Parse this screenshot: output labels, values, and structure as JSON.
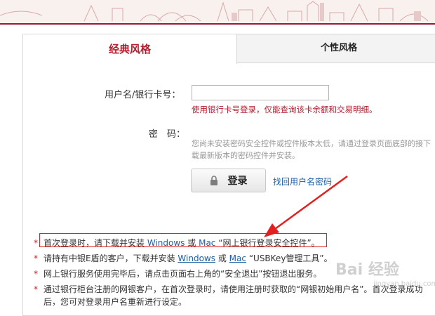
{
  "tabs": {
    "classic": "经典风格",
    "personal": "个性风格"
  },
  "form": {
    "username_label": "用户名/银行卡号：",
    "username_value": "",
    "username_hint": "使用银行卡号登录，仅能查询该卡余额和交易明细。",
    "password_label": "密　码：",
    "password_hint": "您尚未安装密码安全控件或控件版本太低，请通过登录页面底部的接下载最新版本的密码控件并安装。",
    "login_button": "登录",
    "forgot_link": "找回用户名密码"
  },
  "notices": {
    "star": "*",
    "n1_text_a": "首次登录时，请下载并安装",
    "n1_windows": "Windows",
    "n1_or": "或",
    "n1_mac": "Mac",
    "n1_text_b": "“网上银行登录安全控件”。",
    "n2_text_a": "请持有中银E盾的客户，下载并安装",
    "n2_windows": "Windows",
    "n2_or": "或",
    "n2_mac": "Mac",
    "n2_text_b": "“USBKey管理工具”。",
    "n3_text": "网上银行服务使用完毕后，请点击页面右上角的“安全退出”按钮退出服务。",
    "n4_text_a": "通过银行柜台注册的网银客户，在首次登录时，请使用注册时获取的“网银初始用户名”。",
    "n4_text_b": "首次登录成功",
    "n5_text": "后，您可对登录用户名重新进行设定。"
  },
  "watermark": {
    "main": "Bai 经验",
    "sub": "jingyan.baidu.com"
  },
  "colors": {
    "brand_red": "#a3162a",
    "link_blue": "#1b5ea6",
    "annotation_red": "#e32020"
  }
}
